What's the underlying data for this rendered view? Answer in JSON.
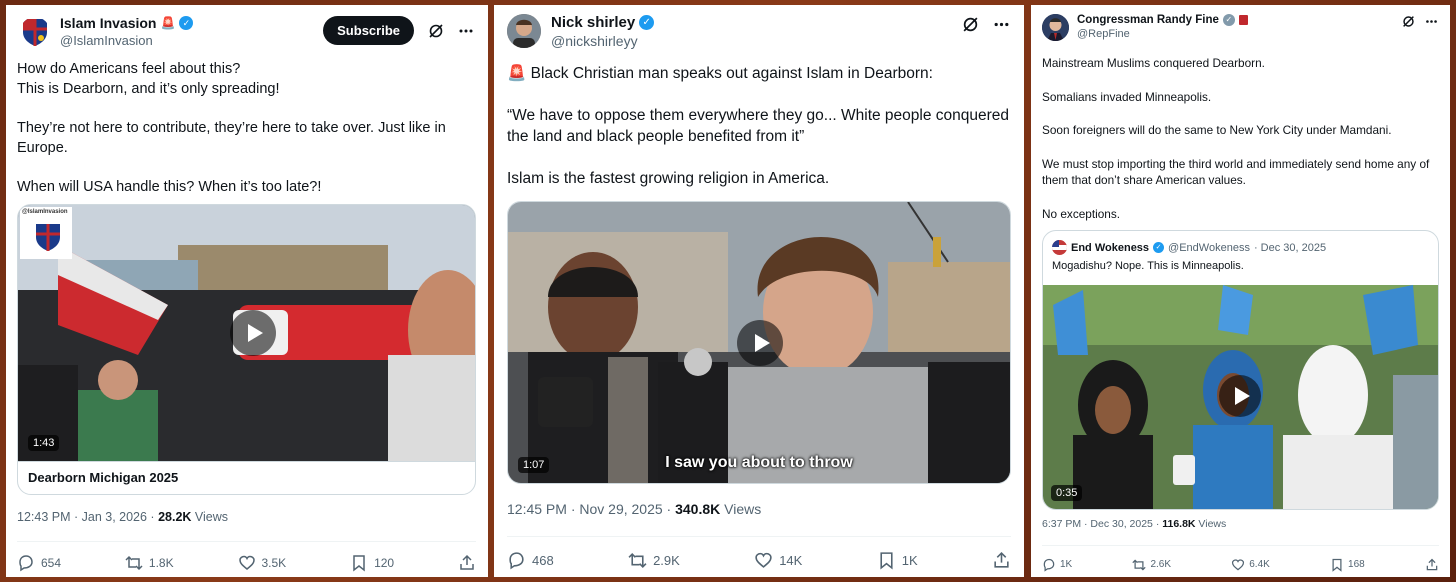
{
  "posts": [
    {
      "author": "Islam Invasion",
      "author_emoji": "🚨",
      "handle": "@IslamInvasion",
      "subscribe_label": "Subscribe",
      "text": "How do Americans feel about this?\nThis is Dearborn, and it’s only spreading!\n\nThey’re not here to contribute, they’re here to take over. Just like in Europe.\n\nWhen will USA handle this? When it’s too late?!",
      "media": {
        "duration": "1:43",
        "watermark": "@IslamInvasion",
        "caption": "Dearborn Michigan 2025"
      },
      "time": "12:43 PM · Jan 3, 2026 · ",
      "views_count": "28.2K",
      "views_label": " Views",
      "replies": "654",
      "reposts": "1.8K",
      "likes": "3.5K",
      "bookmarks": "120"
    },
    {
      "author": "Nick shirley",
      "handle": "@nickshirleyy",
      "text": "🚨 Black Christian man speaks out against Islam in Dearborn:\n\n“We have to oppose them everywhere they go... White people conquered the land and black people benefited from it”\n\nIslam is the fastest growing religion in America.",
      "media": {
        "duration": "1:07",
        "subtitle": "I saw you about to throw"
      },
      "time": "12:45 PM · Nov 29, 2025 · ",
      "views_count": "340.8K",
      "views_label": " Views",
      "replies": "468",
      "reposts": "2.9K",
      "likes": "14K",
      "bookmarks": "1K"
    },
    {
      "author": "Congressman Randy Fine",
      "handle": "@RepFine",
      "text": "Mainstream Muslims conquered Dearborn.\n\nSomalians invaded Minneapolis.\n\nSoon foreigners will do the same to New York City under Mamdani.\n\nWe must stop importing the third world and immediately send home any of them that don’t share American values.\n\nNo exceptions.",
      "quote": {
        "author": "End Wokeness",
        "handle": "@EndWokeness",
        "date": " · Dec 30, 2025",
        "text": "Mogadishu? Nope. This is Minneapolis.",
        "duration": "0:35"
      },
      "time": "6:37 PM · Dec 30, 2025 · ",
      "views_count": "116.8K",
      "views_label": " Views",
      "replies": "1K",
      "reposts": "2.6K",
      "likes": "6.4K",
      "bookmarks": "168"
    }
  ],
  "icons": {
    "grok": "grok-icon",
    "more": "more-icon",
    "reply": "reply-icon",
    "repost": "repost-icon",
    "like": "heart-icon",
    "bookmark": "bookmark-icon",
    "share": "share-icon"
  },
  "colors": {
    "verified": "#1d9bf0",
    "text": "#0f1419",
    "muted": "#536471",
    "background": "#7a3314"
  }
}
